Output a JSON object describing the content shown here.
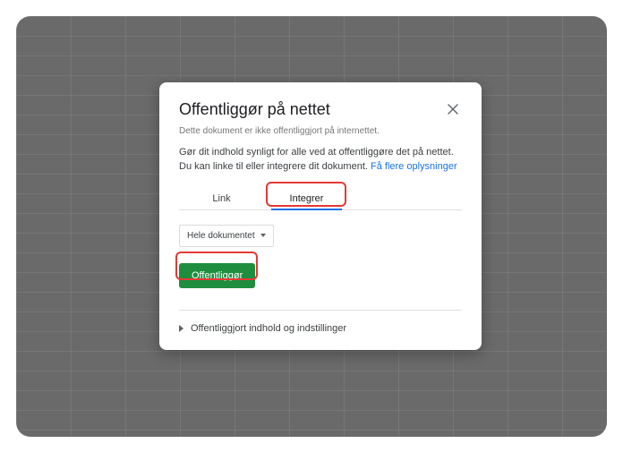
{
  "dialog": {
    "title": "Offentliggør på nettet",
    "subtitle": "Dette dokument er ikke offentliggjort på internettet.",
    "description_prefix": "Gør dit indhold synligt for alle ved at offentliggøre det på nettet. Du kan linke til eller integrere dit dokument. ",
    "learn_more": "Få flere oplysninger",
    "tabs": {
      "link": "Link",
      "integrer": "Integrer"
    },
    "select_label": "Hele dokumentet",
    "publish_button": "Offentliggør",
    "expand_label": "Offentliggjort indhold og indstillinger"
  }
}
